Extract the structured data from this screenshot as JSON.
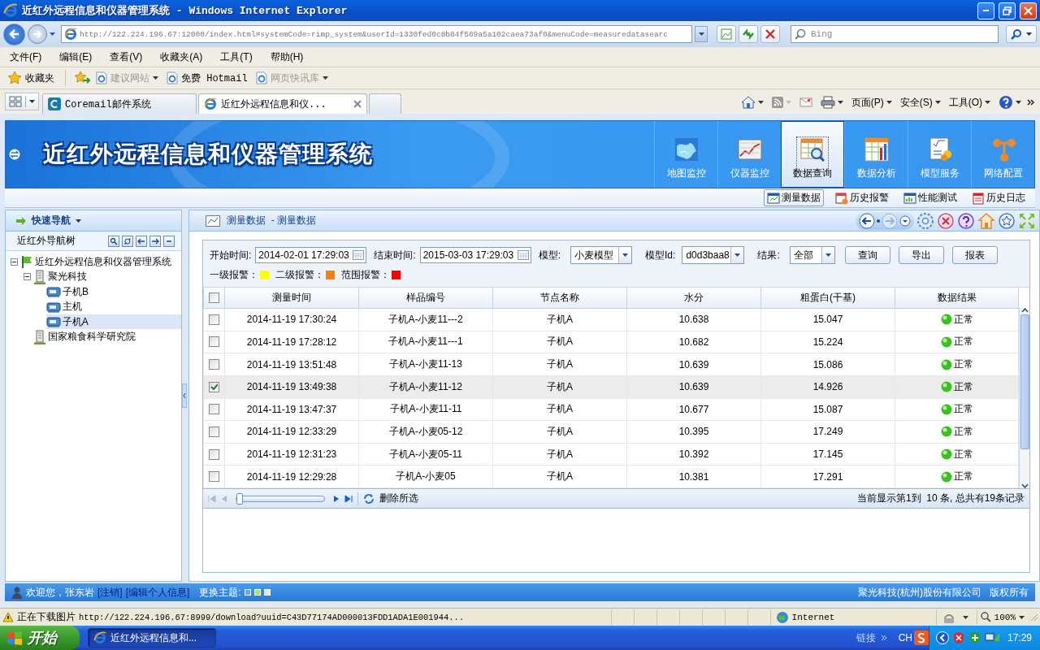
{
  "window": {
    "title": "近红外远程信息和仪器管理系统 - Windows Internet Explorer"
  },
  "address_bar": {
    "value": "http://122.224.196.67:12000/index.html#systemCode=rimp_system&userId=1330fed0c8b84f569a5a102caea73af0&menuCode=measuredatasearc"
  },
  "search": {
    "placeholder": "Bing"
  },
  "menu": [
    "文件(F)",
    "编辑(E)",
    "查看(V)",
    "收藏夹(A)",
    "工具(T)",
    "帮助(H)"
  ],
  "favorites_bar": {
    "title": "收藏夹",
    "items": [
      {
        "label": "建议网站",
        "disabled": true,
        "has_menu": true
      },
      {
        "label": "免费 Hotmail",
        "disabled": false,
        "has_menu": false
      },
      {
        "label": "网页快讯库",
        "disabled": true,
        "has_menu": true
      }
    ]
  },
  "browser_tabs": [
    {
      "label": "Coremail邮件系统",
      "selected": false
    },
    {
      "label": "近红外远程信息和仪...",
      "selected": true
    }
  ],
  "command_bar": [
    "页面(P)",
    "安全(S)",
    "工具(O)"
  ],
  "app": {
    "title": "近红外远程信息和仪器管理系统",
    "modules": [
      {
        "label": "地图监控",
        "selected": false
      },
      {
        "label": "仪器监控",
        "selected": false
      },
      {
        "label": "数据查询",
        "selected": true
      },
      {
        "label": "数据分析",
        "selected": false
      },
      {
        "label": "模型服务",
        "selected": false
      },
      {
        "label": "网络配置",
        "selected": false
      }
    ],
    "sub_nav": [
      {
        "label": "测量数据",
        "selected": true
      },
      {
        "label": "历史报警",
        "selected": false
      },
      {
        "label": "性能测试",
        "selected": false
      },
      {
        "label": "历史日志",
        "selected": false
      }
    ]
  },
  "sidebar": {
    "title": "快速导航",
    "tree_title": "近红外导航树",
    "tree": [
      {
        "label": "近红外远程信息和仪器管理系统",
        "kind": "root",
        "expanded": true,
        "selected": false,
        "children": [
          {
            "label": "聚光科技",
            "kind": "org",
            "expanded": true,
            "selected": false,
            "children": [
              {
                "label": "子机B",
                "kind": "device",
                "selected": false
              },
              {
                "label": "主机",
                "kind": "device",
                "selected": false
              },
              {
                "label": "子机A",
                "kind": "device",
                "selected": true
              }
            ]
          },
          {
            "label": "国家粮食科学研究院",
            "kind": "org",
            "selected": false
          }
        ]
      }
    ]
  },
  "breadcrumb": "测量数据  - 测量数据",
  "filters": {
    "start_label": "开始时间:",
    "start_value": "2014-02-01 17:29:03",
    "end_label": "结束时间:",
    "end_value": "2015-03-03 17:29:03",
    "model_label": "模型:",
    "model_value": "小麦模型",
    "model_id_label": "模型Id:",
    "model_id_value": "d0d3baa8",
    "result_label": "结果:",
    "result_value": "全部",
    "buttons": [
      "查询",
      "导出",
      "报表"
    ],
    "legend": [
      {
        "label": "一级报警：",
        "color": "#ffff00"
      },
      {
        "label": "二级报警：",
        "color": "#ff8000"
      },
      {
        "label": "范围报警：",
        "color": "#ff0000"
      }
    ]
  },
  "table": {
    "all_checked": false,
    "columns": [
      "测量时间",
      "样品编号",
      "节点名称",
      "水分",
      "粗蛋白(干基)",
      "数据结果"
    ],
    "rows": [
      {
        "checked": false,
        "cells": [
          "2014-11-19 17:30:24",
          "子机A-小麦11---2",
          "子机A",
          "10.638",
          "15.047"
        ],
        "result": "正常"
      },
      {
        "checked": false,
        "cells": [
          "2014-11-19 17:28:12",
          "子机A-小麦11---1",
          "子机A",
          "10.682",
          "15.224"
        ],
        "result": "正常"
      },
      {
        "checked": false,
        "cells": [
          "2014-11-19 13:51:48",
          "子机A-小麦11-13",
          "子机A",
          "10.639",
          "15.086"
        ],
        "result": "正常"
      },
      {
        "checked": true,
        "cells": [
          "2014-11-19 13:49:38",
          "子机A-小麦11-12",
          "子机A",
          "10.639",
          "14.926"
        ],
        "result": "正常"
      },
      {
        "checked": false,
        "cells": [
          "2014-11-19 13:47:37",
          "子机A-小麦11-11",
          "子机A",
          "10.677",
          "15.087"
        ],
        "result": "正常"
      },
      {
        "checked": false,
        "cells": [
          "2014-11-19 12:33:29",
          "子机A-小麦05-12",
          "子机A",
          "10.395",
          "17.249"
        ],
        "result": "正常"
      },
      {
        "checked": false,
        "cells": [
          "2014-11-19 12:31:23",
          "子机A-小麦05-11",
          "子机A",
          "10.392",
          "17.145"
        ],
        "result": "正常"
      },
      {
        "checked": false,
        "cells": [
          "2014-11-19 12:29:28",
          "子机A-小麦05",
          "子机A",
          "10.381",
          "17.291"
        ],
        "result": "正常"
      }
    ]
  },
  "pager": {
    "level": 0,
    "action": "删除所选",
    "summary": "当前显示第1到  10 条, 总共有19条记录"
  },
  "footer": {
    "welcome": "欢迎您，张东岩",
    "links": [
      "[注销]",
      "[编辑个人信息]"
    ],
    "theme_label": "更换主题:",
    "themes": [
      {
        "color": "#6fa8e8"
      },
      {
        "color": "#b8e04a"
      },
      {
        "color": "#e8e8e8"
      }
    ],
    "company": "聚光科技(杭州)股份有限公司",
    "rights": "版权所有"
  },
  "status_bar": {
    "text": "正在下载图片",
    "url": "http://122.224.196.67:8999/download?uuid=C43D77174AD000013FDD1ADA1E001944...",
    "zone": "Internet",
    "zoom": "100%"
  },
  "taskbar": {
    "start": "开始",
    "tasks": [
      {
        "label": "近红外远程信息和...",
        "selected": true
      }
    ],
    "links": "链接",
    "language": "CH",
    "time": "17:29"
  }
}
